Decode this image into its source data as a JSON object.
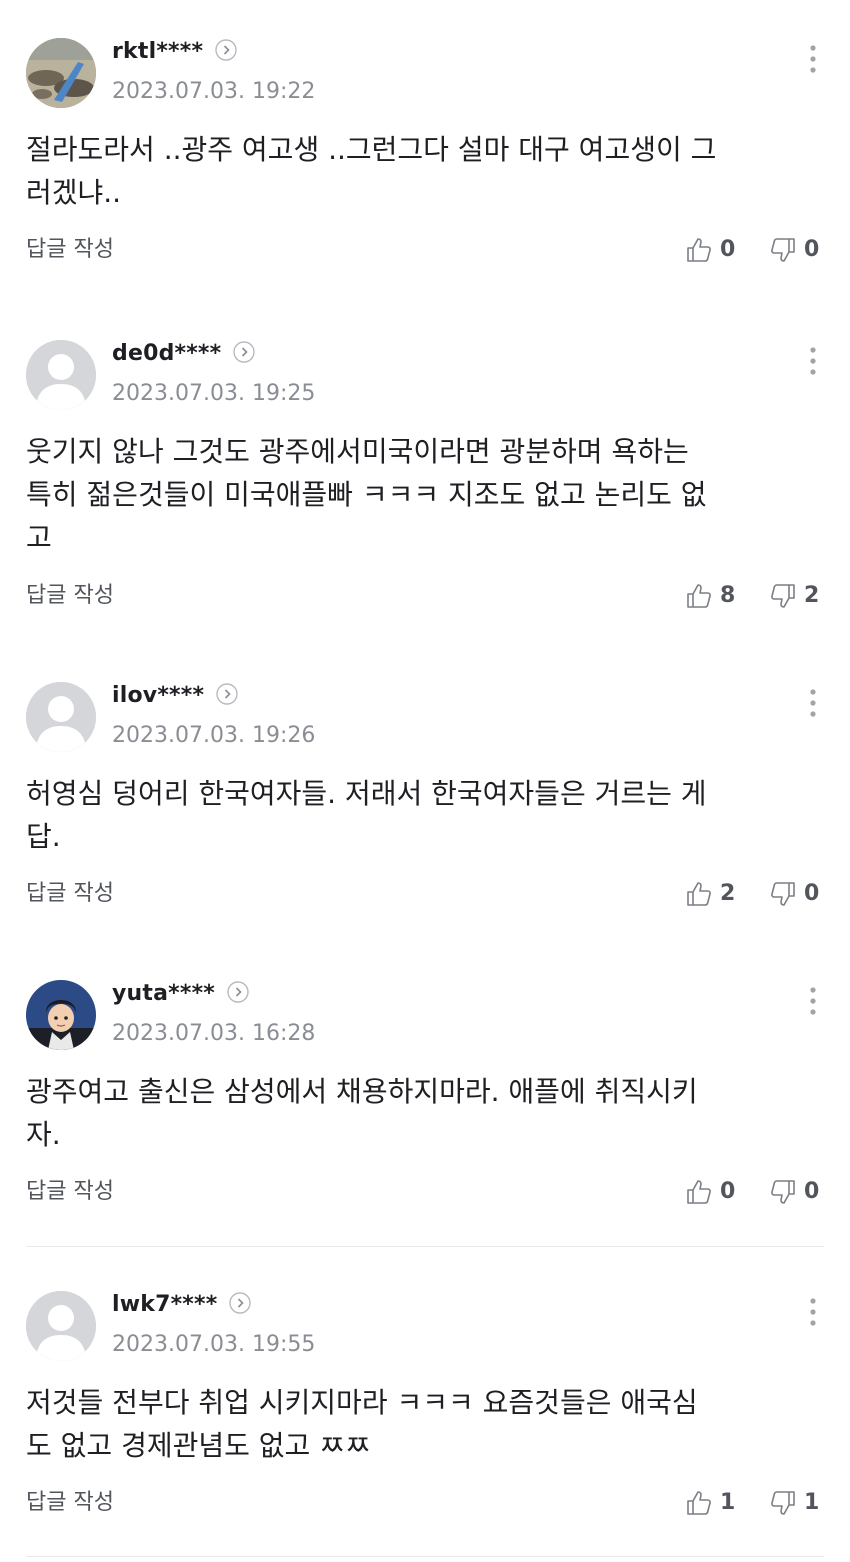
{
  "reply_label": "답글 작성",
  "comments": [
    {
      "nick": "rktl****",
      "date": "2023.07.03. 19:22",
      "lines": [
        "절라도라서 ..광주 여고생 ..그런그다 설마 대구 여고생이 그",
        "러겠냐.."
      ],
      "likes": "0",
      "dislikes": "0"
    },
    {
      "nick": "de0d****",
      "date": "2023.07.03. 19:25",
      "lines": [
        "웃기지 않나 그것도 광주에서미국이라면 광분하며 욕하는",
        "특히 젊은것들이 미국애플빠 ㅋㅋㅋ 지조도 없고 논리도 없",
        "고"
      ],
      "likes": "8",
      "dislikes": "2"
    },
    {
      "nick": "ilov****",
      "date": "2023.07.03. 19:26",
      "lines": [
        "허영심 덩어리 한국여자들. 저래서 한국여자들은 거르는 게",
        "답."
      ],
      "likes": "2",
      "dislikes": "0"
    },
    {
      "nick": "yuta****",
      "date": "2023.07.03. 16:28",
      "lines": [
        "광주여고 출신은 삼성에서 채용하지마라. 애플에 취직시키",
        "자."
      ],
      "likes": "0",
      "dislikes": "0"
    },
    {
      "nick": "lwk7****",
      "date": "2023.07.03. 19:55",
      "lines": [
        "저것들 전부다 취업 시키지마라 ㅋㅋㅋ 요즘것들은 애국심",
        "도 없고 경제관념도 없고 ㅉㅉ"
      ],
      "likes": "1",
      "dislikes": "1"
    }
  ]
}
